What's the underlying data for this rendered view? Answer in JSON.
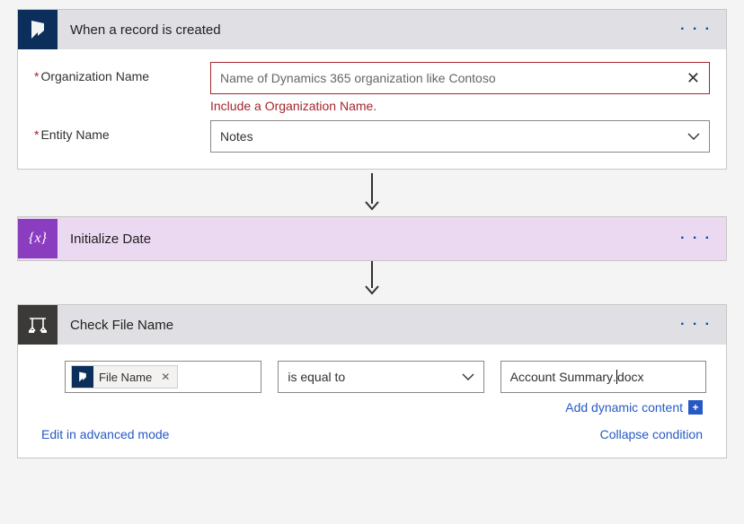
{
  "step1": {
    "title": "When a record is created",
    "menu": "· · ·",
    "fields": {
      "org": {
        "label": "Organization Name",
        "placeholder": "Name of Dynamics 365 organization like Contoso",
        "error": "Include a Organization Name."
      },
      "entity": {
        "label": "Entity Name",
        "value": "Notes"
      }
    }
  },
  "step2": {
    "title": "Initialize Date",
    "menu": "· · ·"
  },
  "step3": {
    "title": "Check File Name",
    "menu": "· · ·",
    "condition": {
      "token_label": "File Name",
      "operator": "is equal to",
      "value_before": "Account Summary",
      "value_after": "docx",
      "add_dynamic": "Add dynamic content",
      "edit_advanced": "Edit in advanced mode",
      "collapse": "Collapse condition"
    }
  }
}
